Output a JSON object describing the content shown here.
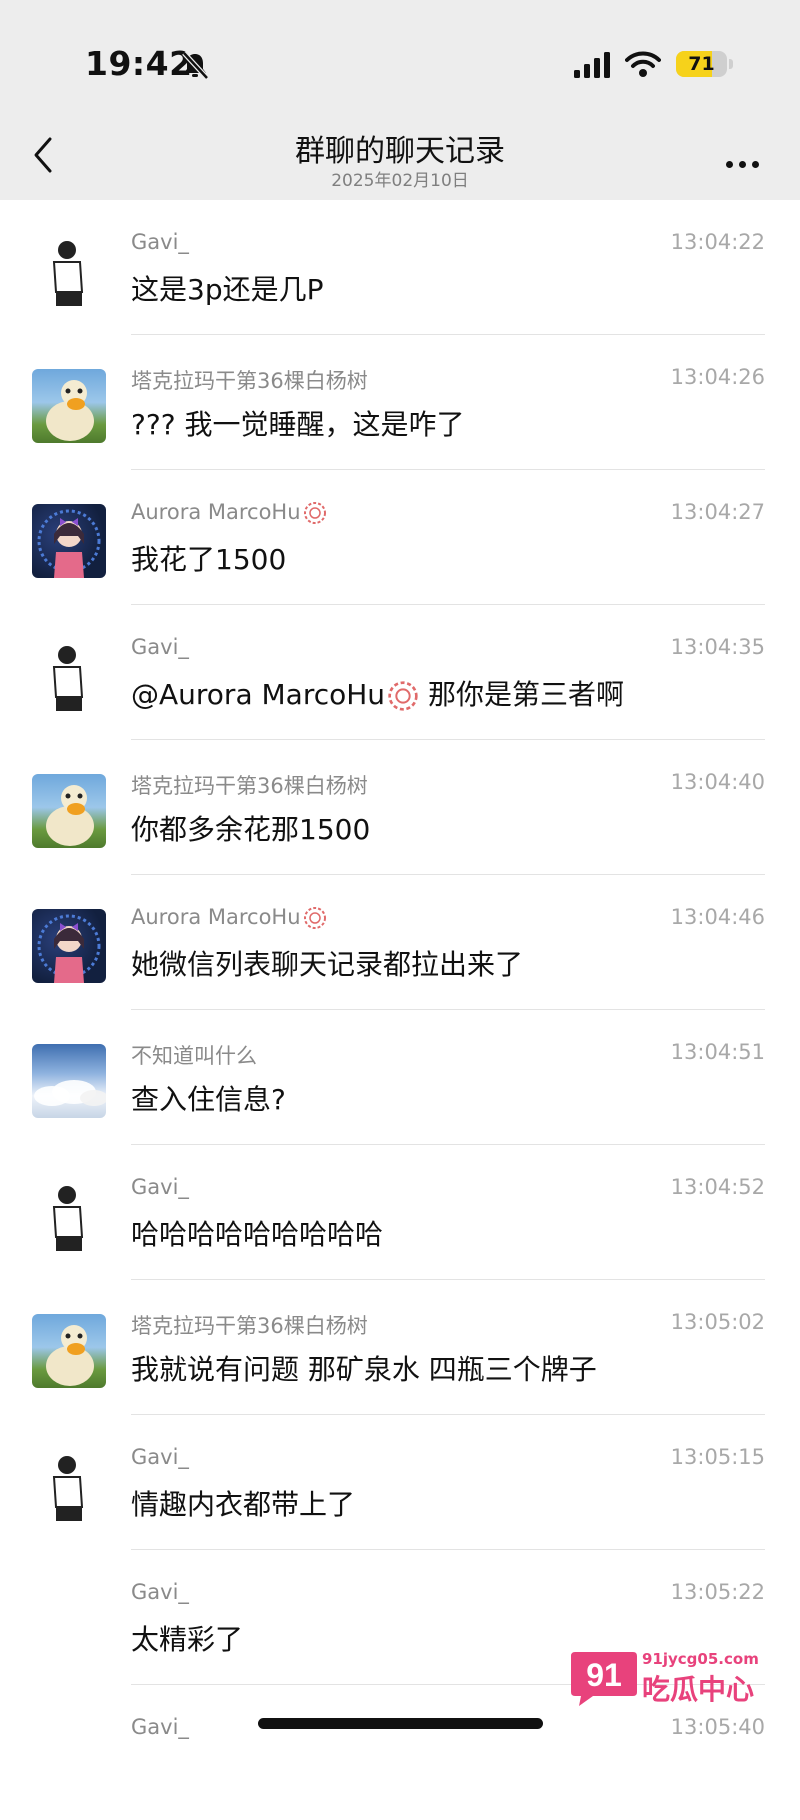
{
  "status_bar": {
    "time": "19:42",
    "battery": "71",
    "battery_level": 0.71
  },
  "header": {
    "title": "群聊的聊天记录",
    "subtitle": "2025年02月10日"
  },
  "messages": [
    {
      "name": "Gavi_",
      "time": "13:04:22",
      "text": "这是3p还是几P",
      "avatar": "gavi"
    },
    {
      "name": "塔克拉玛干第36棵白杨树",
      "time": "13:04:26",
      "text": "???  我一觉睡醒，这是咋了",
      "avatar": "duck"
    },
    {
      "name": "Aurora MarcoHu",
      "time": "13:04:27",
      "text": "我花了1500",
      "avatar": "aurora"
    },
    {
      "name": "Gavi_",
      "time": "13:04:35",
      "text": "@Aurora MarcoHu",
      "text_after": " 那你是第三者啊",
      "avatar": "gavi"
    },
    {
      "name": "塔克拉玛干第36棵白杨树",
      "time": "13:04:40",
      "text": "你都多余花那1500",
      "avatar": "duck"
    },
    {
      "name": "Aurora MarcoHu",
      "time": "13:04:46",
      "text": "她微信列表聊天记录都拉出来了",
      "avatar": "aurora"
    },
    {
      "name": "不知道叫什么",
      "time": "13:04:51",
      "text": "查入住信息?",
      "avatar": "sky"
    },
    {
      "name": "Gavi_",
      "time": "13:04:52",
      "text": "哈哈哈哈哈哈哈哈哈",
      "avatar": "gavi"
    },
    {
      "name": "塔克拉玛干第36棵白杨树",
      "time": "13:05:02",
      "text": "我就说有问题 那矿泉水 四瓶三个牌子",
      "avatar": "duck"
    },
    {
      "name": "Gavi_",
      "time": "13:05:15",
      "text": "情趣内衣都带上了",
      "avatar": "gavi"
    },
    {
      "name": "Gavi_",
      "time": "13:05:22",
      "text": "太精彩了",
      "avatar": "none"
    },
    {
      "name": "Gavi_",
      "time": "13:05:40",
      "text": "",
      "avatar": "none"
    }
  ],
  "watermark": {
    "number": "91",
    "url": "91jycg05.com",
    "brand": "吃瓜中心"
  },
  "icons": {
    "bell": "bell-slash-icon",
    "signal": "cellular-signal-icon",
    "wifi": "wifi-icon",
    "back": "chevron-left-icon",
    "more": "more-dots-icon",
    "badge": "red-seal-badge-icon"
  }
}
